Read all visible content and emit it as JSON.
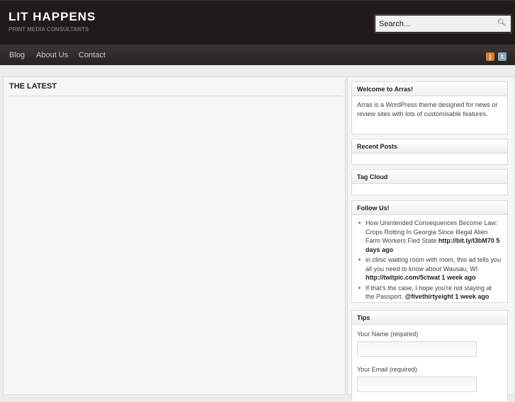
{
  "site": {
    "title": "LIT HAPPENS",
    "tagline": "PRINT MEDIA CONSULTANTS"
  },
  "search": {
    "placeholder": "Search..."
  },
  "nav": [
    "Blog",
    "About Us",
    "Contact"
  ],
  "social": {
    "rss": "rss-icon",
    "twitter": "twitter-icon",
    "rss_color": "#e07b2c",
    "twitter_color": "#8aa9bf"
  },
  "main": {
    "heading": "THE LATEST"
  },
  "widgets": {
    "welcome": {
      "title": "Welcome to Arras!",
      "text": "Arras is a WordPress theme designed for news or review sites with lots of customisable features."
    },
    "recent": {
      "title": "Recent Posts"
    },
    "tags": {
      "title": "Tag Cloud"
    },
    "follow": {
      "title": "Follow Us!",
      "tweets": [
        {
          "text": "How Unintended Consequences Become Law: Crops Rotting In Georgia Since Illegal Alien Farm Workers Fled State ",
          "link": "http://bit.ly/l3bM70",
          "time": "5 days ago"
        },
        {
          "text": "in clinic waiting room with mom, this ad tells you all you need to know about Wausau, WI ",
          "link": "http://twitpic.com/5ctwat",
          "time": "1 week ago"
        },
        {
          "text": "If that's the case, I hope you're not staying at the Passport. ",
          "link": "@fivethirtyeight",
          "time": "1 week ago"
        }
      ]
    },
    "tips": {
      "title": "Tips",
      "name_label": "Your Name (required)",
      "email_label": "Your Email (required)"
    }
  }
}
